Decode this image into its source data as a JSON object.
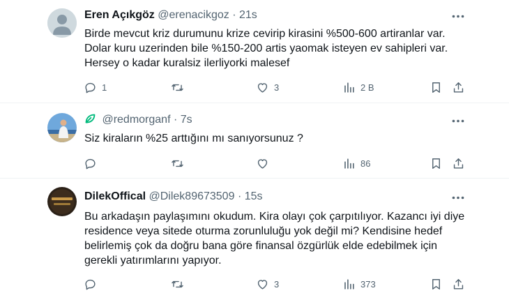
{
  "tweets": [
    {
      "name": "Eren Açıkgöz",
      "handle": "@erenacikgoz",
      "dot": "·",
      "time": "21s",
      "lines": [
        "Birde mevcut kriz durumunu krize cevirip kirasini %500-600 artiranlar var.",
        "Dolar kuru uzerinden bile %150-200 artis yaomak isteyen ev sahipleri var.",
        "Hersey o kadar kuralsiz ilerliyorki malesef"
      ],
      "replies": "1",
      "retweets": "",
      "likes": "3",
      "views": "2 B",
      "avatar": "default-avatar"
    },
    {
      "name": "",
      "handle": "@redmorganf",
      "dot": "·",
      "time": "7s",
      "lines": [
        "Siz kiraların %25 arttığını mı sanıyorsunuz ?"
      ],
      "replies": "",
      "retweets": "",
      "likes": "",
      "views": "86",
      "avatar": "photo-avatar",
      "name_icon": "green-leaf-icon"
    },
    {
      "name": "DilekOffical",
      "handle": "@Dilek89673509",
      "dot": "·",
      "time": "15s",
      "lines": [
        "Bu arkadaşın paylaşımını okudum. Kira olayı çok çarpıtılıyor. Kazancı iyi diye",
        "residence veya sitede oturma zorunluluğu yok değil mi? Kendisine hedef",
        "belirlemiş çok da doğru bana göre finansal özgürlük elde edebilmek için",
        "gerekli yatırımlarını yapıyor."
      ],
      "replies": "",
      "retweets": "",
      "likes": "3",
      "views": "373",
      "avatar": "dark-photo-avatar"
    }
  ],
  "colors": {
    "text": "#0f1419",
    "muted": "#536471",
    "divider": "#eff3f4",
    "leaf": "#00ba7c"
  }
}
